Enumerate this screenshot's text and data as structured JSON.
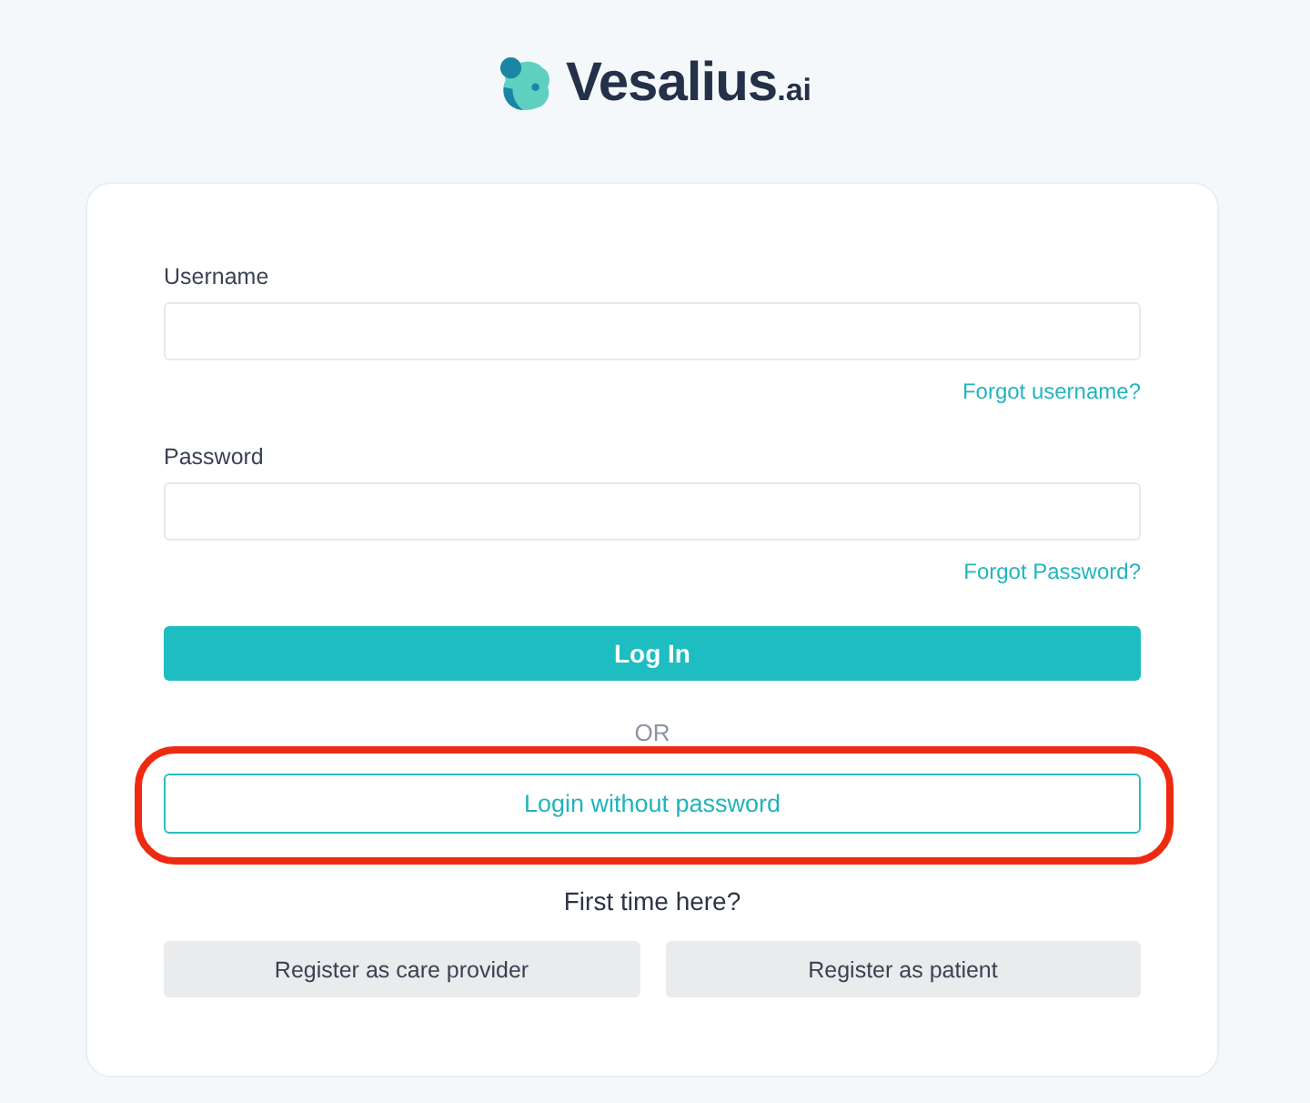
{
  "logo": {
    "name": "Vesalius",
    "suffix": ".ai"
  },
  "form": {
    "fields": [
      {
        "label": "Username",
        "link": "Forgot username?"
      },
      {
        "label": "Password",
        "link": "Forgot Password?"
      }
    ],
    "login_button": "Log In",
    "separator": "OR",
    "passwordless": {
      "label": "Login without password",
      "highlighted": true
    }
  },
  "register": {
    "prompt": "First time here?",
    "buttons": [
      "Register as care provider",
      "Register as patient"
    ]
  }
}
